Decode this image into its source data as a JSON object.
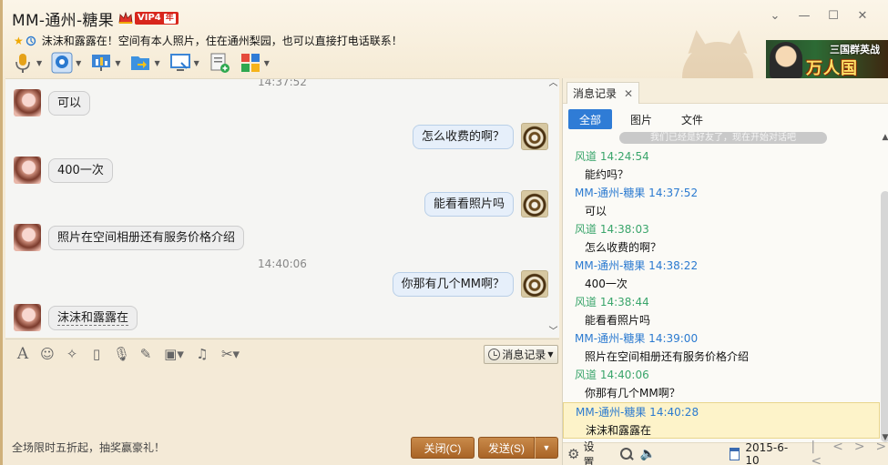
{
  "header": {
    "title": "MM-通州-糖果",
    "vip_label": "VIP4",
    "vip_year": "年",
    "signature": "沫沫和露露在！空间有本人照片，住在通州梨园，也可以直接打电话联系！"
  },
  "ad": {
    "top_text": "三国群英战",
    "main_text": "万人国战！"
  },
  "chat": {
    "time_top": "14:37:52",
    "time_mid": "14:40:06",
    "messages": [
      {
        "side": "left",
        "text": "可以"
      },
      {
        "side": "right",
        "text": "怎么收费的啊？"
      },
      {
        "side": "left",
        "text": "400一次"
      },
      {
        "side": "right",
        "text": "能看看照片吗"
      },
      {
        "side": "left",
        "text": "照片在空间相册还有服务价格介绍"
      },
      {
        "side": "right",
        "text": "你那有几个MM啊？"
      },
      {
        "side": "left",
        "text": "沫沫和露露在"
      }
    ]
  },
  "input_toolbar": {
    "history_button": "消息记录"
  },
  "footer": {
    "promo": "全场限时五折起，抽奖赢豪礼！",
    "close_label": "关闭(C)",
    "send_label": "发送(S)"
  },
  "history": {
    "tab_label": "消息记录",
    "filters": [
      "全部",
      "图片",
      "文件"
    ],
    "faded_notice": "我们已经是好友了，现在开始对话吧",
    "entries": [
      {
        "who": "peer",
        "head": "风道 14:24:54",
        "text": "能约吗？"
      },
      {
        "who": "me",
        "head": "MM-通州-糖果 14:37:52",
        "text": "可以"
      },
      {
        "who": "peer",
        "head": "风道 14:38:03",
        "text": "怎么收费的啊？"
      },
      {
        "who": "me",
        "head": "MM-通州-糖果 14:38:22",
        "text": "400一次"
      },
      {
        "who": "peer",
        "head": "风道 14:38:44",
        "text": "能看看照片吗"
      },
      {
        "who": "me",
        "head": "MM-通州-糖果 14:39:00",
        "text": "照片在空间相册还有服务价格介绍"
      },
      {
        "who": "peer",
        "head": "风道 14:40:06",
        "text": "你那有几个MM啊？"
      },
      {
        "who": "me",
        "head": "MM-通州-糖果 14:40:28",
        "text": "沫沫和露露在"
      }
    ],
    "settings_label": "设置",
    "date": "2015-6-10"
  }
}
